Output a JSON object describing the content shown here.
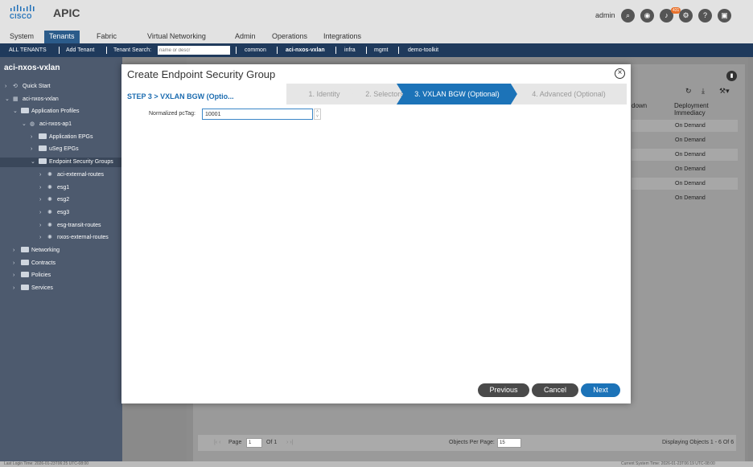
{
  "header": {
    "logo_text": "CISCO",
    "app_title": "APIC",
    "user": "admin",
    "notification_count": "431",
    "icons": [
      "search-icon",
      "video-icon",
      "bell-icon",
      "gear-icon",
      "help-icon",
      "feedback-icon"
    ]
  },
  "tabs": [
    {
      "label": "System"
    },
    {
      "label": "Tenants",
      "active": true
    },
    {
      "label": "Fabric"
    },
    {
      "label": "Virtual Networking"
    },
    {
      "label": "Admin"
    },
    {
      "label": "Operations"
    },
    {
      "label": "Integrations"
    }
  ],
  "subnav": {
    "all_tenants": "ALL TENANTS",
    "add_tenant": "Add Tenant",
    "search_label": "Tenant Search:",
    "search_placeholder": "name or descr",
    "items": [
      "common",
      "aci-nxos-vxlan",
      "infra",
      "mgmt",
      "demo-toolkit"
    ]
  },
  "sidebar": {
    "title": "aci-nxos-vxlan",
    "tree": [
      {
        "label": "Quick Start"
      },
      {
        "label": "aci-nxos-vxlan"
      },
      {
        "label": "Application Profiles"
      },
      {
        "label": "aci-nxos-ap1"
      },
      {
        "label": "Application EPGs"
      },
      {
        "label": "uSeg EPGs"
      },
      {
        "label": "Endpoint Security Groups",
        "selected": true
      },
      {
        "label": "aci-external-routes"
      },
      {
        "label": "esg1"
      },
      {
        "label": "esg2"
      },
      {
        "label": "esg3"
      },
      {
        "label": "esg-transit-routes"
      },
      {
        "label": "nxos-external-routes"
      },
      {
        "label": "Networking"
      },
      {
        "label": "Contracts"
      },
      {
        "label": "Policies"
      },
      {
        "label": "Services"
      }
    ]
  },
  "background_table": {
    "col_partial": "down",
    "col_deploy": "Deployment Immediacy",
    "rows": [
      "On Demand",
      "On Demand",
      "On Demand",
      "On Demand",
      "On Demand",
      "On Demand"
    ]
  },
  "pager": {
    "page_label": "Page",
    "page_value": "1",
    "of_label": "Of 1",
    "per_page_label": "Objects Per Page:",
    "per_page_value": "15",
    "displaying": "Displaying Objects 1 - 6 Of 6"
  },
  "status": {
    "last_login": "Last Login Time: 2026-01-23T06:25 UTC-08:00",
    "server_time": "Current System Time: 2026-01-23T06:19 UTC-08:00"
  },
  "modal": {
    "title": "Create Endpoint Security Group",
    "step_label": "STEP 3 > VXLAN BGW (Optio...",
    "steps": [
      {
        "label": "1. Identity",
        "active": false
      },
      {
        "label": "2. Selectors",
        "active": false
      },
      {
        "label": "3. VXLAN BGW (Optional)",
        "active": true
      },
      {
        "label": "4. Advanced (Optional)",
        "active": false
      }
    ],
    "field_label": "Normalized pcTag:",
    "field_value": "10001",
    "buttons": {
      "previous": "Previous",
      "cancel": "Cancel",
      "next": "Next"
    },
    "colors": {
      "active_step": "#1c73b8",
      "next_button": "#1c73b8"
    }
  }
}
